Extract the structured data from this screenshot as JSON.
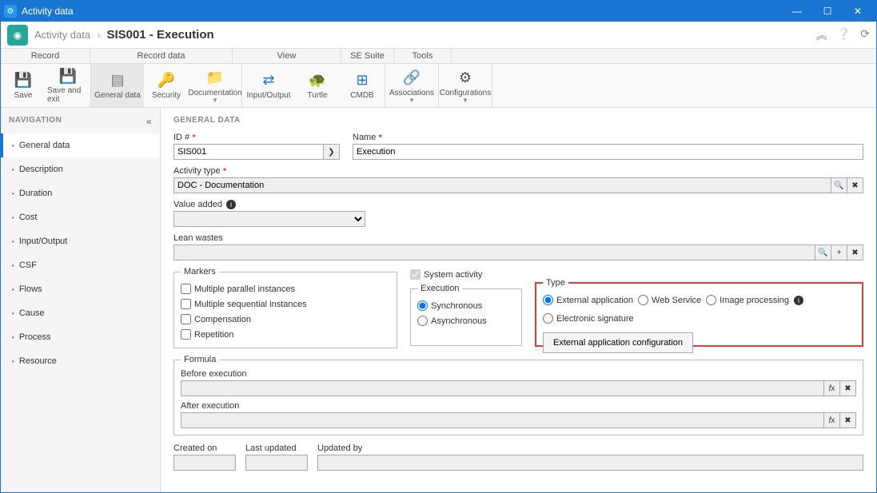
{
  "titlebar": {
    "title": "Activity data"
  },
  "breadcrumb": {
    "root": "Activity data",
    "current": "SIS001 - Execution"
  },
  "ribbon": {
    "tabs": [
      "Record",
      "Record data",
      "View",
      "SE Suite",
      "Tools"
    ],
    "buttons": {
      "save": "Save",
      "save_exit": "Save and exit",
      "general_data": "General data",
      "security": "Security",
      "documentation": "Documentation",
      "io": "Input/Output",
      "turtle": "Turtle",
      "cmdb": "CMDB",
      "associations": "Associations",
      "configurations": "Configurations"
    }
  },
  "nav": {
    "header": "NAVIGATION",
    "items": [
      "General data",
      "Description",
      "Duration",
      "Cost",
      "Input/Output",
      "CSF",
      "Flows",
      "Cause",
      "Process",
      "Resource"
    ],
    "active_index": 0
  },
  "form": {
    "section": "GENERAL DATA",
    "labels": {
      "id": "ID #",
      "name": "Name",
      "activity_type": "Activity type",
      "value_added": "Value added",
      "lean_wastes": "Lean wastes",
      "markers": "Markers",
      "system_activity": "System activity",
      "execution": "Execution",
      "type": "Type",
      "formula": "Formula",
      "before_exec": "Before execution",
      "after_exec": "After execution",
      "created_on": "Created on",
      "last_updated": "Last updated",
      "updated_by": "Updated by"
    },
    "values": {
      "id": "SIS001",
      "name": "Execution",
      "activity_type": "DOC - Documentation",
      "value_added": "",
      "lean_wastes": "",
      "before_exec": "",
      "after_exec": "",
      "created_on": "",
      "last_updated": "",
      "updated_by": ""
    },
    "markers": {
      "mpi": "Multiple parallel instances",
      "msi": "Multiple sequential instances",
      "comp": "Compensation",
      "rep": "Repetition"
    },
    "execution_opts": {
      "sync": "Synchronous",
      "async": "Asynchronous",
      "selected": "sync"
    },
    "type_opts": {
      "ext": "External application",
      "ws": "Web Service",
      "img": "Image processing",
      "sig": "Electronic signature",
      "selected": "ext",
      "config_btn": "External application configuration"
    }
  }
}
